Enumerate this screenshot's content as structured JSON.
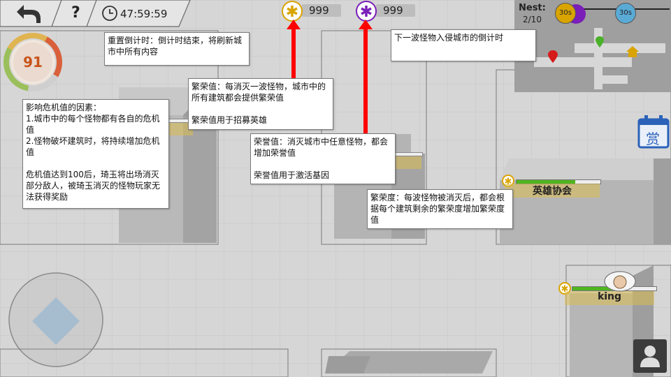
{
  "hud": {
    "back_icon": "back-arrow-icon",
    "help_label": "?",
    "countdown": "47:59:59",
    "prosperity_value": "999",
    "honor_value": "999",
    "crisis_value": "91"
  },
  "minimap": {
    "nest_label": "Nest:",
    "nest_count": "2/10",
    "timer_1": "30s",
    "timer_2": "30s"
  },
  "buildings": {
    "hero_association": "英雄协会",
    "king": "king"
  },
  "tips": {
    "reset_countdown": "重置倒计时：倒计时结束，将刷新城市中所有内容",
    "next_wave": "下一波怪物入侵城市的倒计时",
    "prosperity_1": "繁荣值：每消灭一波怪物，城市中的所有建筑都会提供繁荣值",
    "prosperity_2": "繁荣值用于招募英雄",
    "crisis_title": "影响危机值的因素：",
    "crisis_1": "1.城市中的每个怪物都有各自的危机值",
    "crisis_2": "2.怪物破坏建筑时，将持续增加危机值",
    "crisis_3": "危机值达到100后，琦玉将出场消灭部分敌人，被琦玉消灭的怪物玩家无法获得奖励",
    "honor_1": "荣誉值：消灭城市中任意怪物，都会增加荣誉值",
    "honor_2": "荣誉值用于激活基因",
    "building_prosperity": "繁荣度：每波怪物被消灭后，都会根据每个建筑剩余的繁荣度增加繁荣度值"
  },
  "reward_button": "赏",
  "colors": {
    "prosperity": "#d9a400",
    "honor": "#7a1fb8",
    "arrow": "#ff0000",
    "crisis_number": "#c8541a"
  },
  "icons": {
    "clock": "clock-icon",
    "profile": "profile-icon",
    "joystick": "joystick-icon",
    "map_pin": "map-pin-icon",
    "home": "home-icon",
    "calendar": "calendar-reward-icon"
  }
}
